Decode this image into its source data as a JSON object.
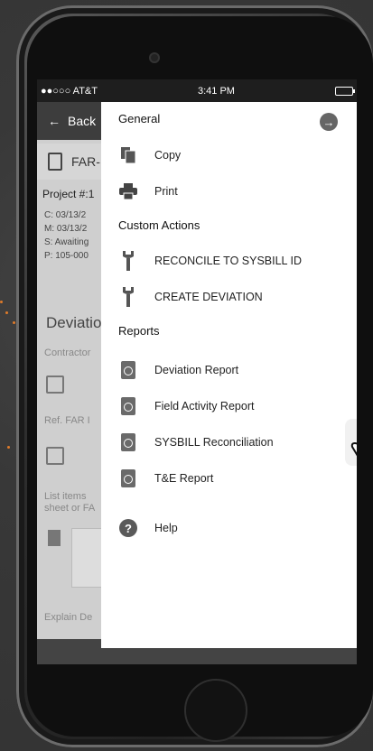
{
  "statusbar": {
    "carrier": "●●○○○ AT&T",
    "time": "3:41 PM"
  },
  "app": {
    "back_label": "Back",
    "far_title": "FAR-",
    "project_label": "Project #:1",
    "meta": [
      "C: 03/13/2",
      "M: 03/13/2",
      "S: Awaiting",
      "P: 105-000"
    ],
    "deviation_title": "Deviatio",
    "contractor_label": "Contractor",
    "ref_label": "Ref. FAR I",
    "list_items_label": "List items",
    "sheet_label": "sheet or FA",
    "explain_label": "Explain De"
  },
  "drawer": {
    "general_header": "General",
    "copy_label": "Copy",
    "print_label": "Print",
    "custom_actions_header": "Custom Actions",
    "reconcile_label": "RECONCILE TO SYSBILL ID",
    "create_deviation_label": "CREATE DEVIATION",
    "reports_header": "Reports",
    "deviation_report_label": "Deviation Report",
    "field_activity_label": "Field Activity Report",
    "sysbill_label": "SYSBILL Reconciliation",
    "te_report_label": "T&E Report",
    "help_label": "Help"
  },
  "colors": {
    "accent_dots": "#e07b2a",
    "navbar": "#3d3d3d"
  }
}
